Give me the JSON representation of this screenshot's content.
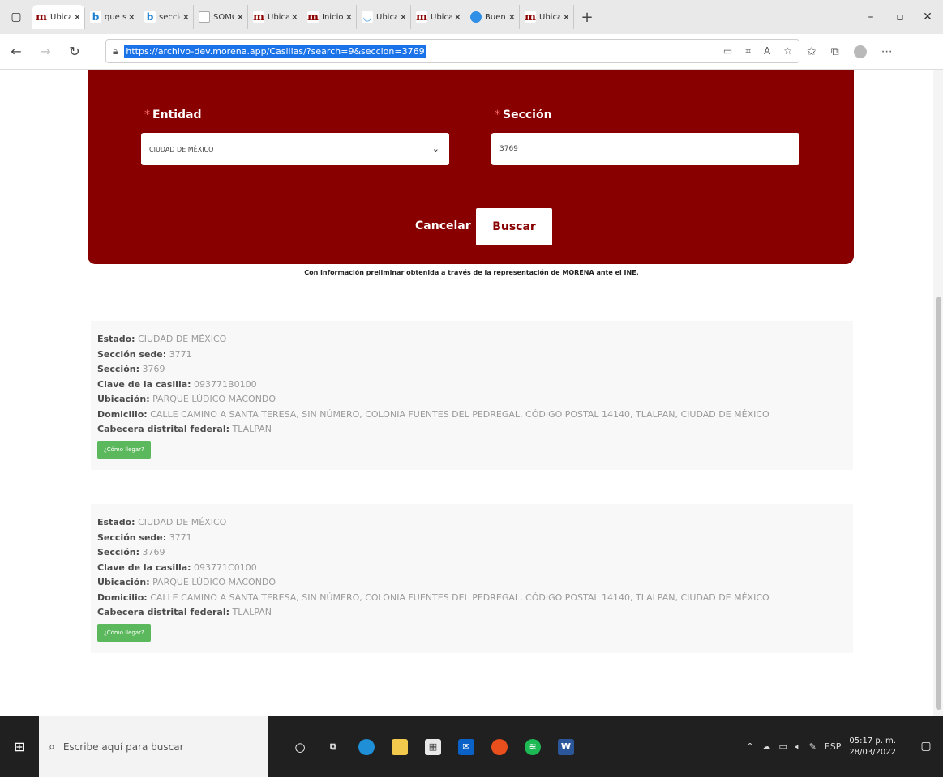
{
  "browser": {
    "tabs": [
      {
        "icon": "morena-icon",
        "label": "Ubicaci",
        "active": true
      },
      {
        "icon": "bing-icon",
        "label": "que ser",
        "active": false
      },
      {
        "icon": "bing-icon",
        "label": "seccion",
        "active": false
      },
      {
        "icon": "page-icon",
        "label": "SOMGE",
        "active": false
      },
      {
        "icon": "morena-icon",
        "label": "Ubicaci",
        "active": false
      },
      {
        "icon": "morena-icon",
        "label": "Inicio -",
        "active": false
      },
      {
        "icon": "ubicacion-icon",
        "label": "Ubicaci",
        "active": false
      },
      {
        "icon": "morena-icon",
        "label": "Ubicaci",
        "active": false
      },
      {
        "icon": "edge-icon",
        "label": "Buenas",
        "active": false
      },
      {
        "icon": "morena-icon",
        "label": "Ubicaci",
        "active": false
      }
    ],
    "url": "https://archivo-dev.morena.app/Casillas/?search=9&seccion=3769"
  },
  "search": {
    "entidad_label": "Entidad",
    "seccion_label": "Sección",
    "entidad_value": "CIUDAD DE MÉXICO",
    "seccion_value": "3769",
    "cancel_label": "Cancelar",
    "search_label": "Buscar"
  },
  "disclaimer": "Con información preliminar obtenida a través de la representación de MORENA ante el INE.",
  "field_labels": {
    "estado": "Estado:",
    "seccion_sede": "Sección sede:",
    "seccion": "Sección:",
    "clave": "Clave de la casilla:",
    "ubicacion": "Ubicación:",
    "domicilio": "Domicilio:",
    "cabecera": "Cabecera distrital federal:"
  },
  "results": [
    {
      "estado": "CIUDAD DE MÉXICO",
      "seccion_sede": "3771",
      "seccion": "3769",
      "clave": "093771B0100",
      "ubicacion": "PARQUE LÚDICO MACONDO",
      "domicilio": "CALLE CAMINO A SANTA TERESA, SIN NÚMERO, COLONIA FUENTES DEL PEDREGAL, CÓDIGO POSTAL 14140, TLALPAN, CIUDAD DE MÉXICO",
      "cabecera": "TLALPAN",
      "button": "¿Cómo llegar?"
    },
    {
      "estado": "CIUDAD DE MÉXICO",
      "seccion_sede": "3771",
      "seccion": "3769",
      "clave": "093771C0100",
      "ubicacion": "PARQUE LÚDICO MACONDO",
      "domicilio": "CALLE CAMINO A SANTA TERESA, SIN NÚMERO, COLONIA FUENTES DEL PEDREGAL, CÓDIGO POSTAL 14140, TLALPAN, CIUDAD DE MÉXICO",
      "cabecera": "TLALPAN",
      "button": "¿Cómo llegar?"
    }
  ],
  "taskbar": {
    "search_placeholder": "Escribe aquí para buscar",
    "language": "ESP",
    "time": "05:17 p. m.",
    "date": "28/03/2022"
  },
  "colors": {
    "brand": "#880000",
    "go_button": "#5cb85c",
    "url_selection": "#1a73e8"
  }
}
